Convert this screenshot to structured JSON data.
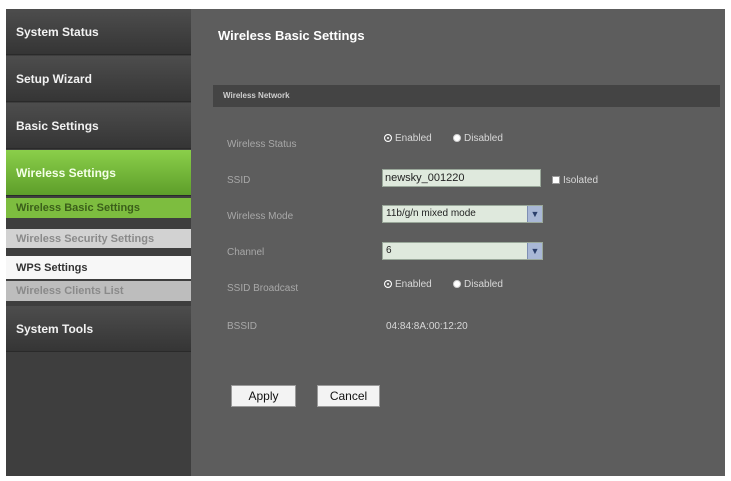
{
  "sidebar": {
    "items": [
      {
        "label": "System Status"
      },
      {
        "label": "Setup Wizard"
      },
      {
        "label": "Basic Settings"
      },
      {
        "label": "Wireless Settings"
      },
      {
        "label": "System Tools"
      }
    ],
    "sub_items": [
      {
        "label": "Wireless Basic Settings"
      },
      {
        "label": "Wireless Security Settings"
      },
      {
        "label": "WPS Settings"
      },
      {
        "label": "Wireless Clients List"
      }
    ]
  },
  "main": {
    "title": "Wireless Basic Settings",
    "section_title": "Wireless Network",
    "fields": {
      "wireless_status": {
        "label": "Wireless Status",
        "enabled_label": "Enabled",
        "disabled_label": "Disabled",
        "selected": "Enabled"
      },
      "ssid": {
        "label": "SSID",
        "value": "newsky_001220",
        "isolated_label": "Isolated"
      },
      "wireless_mode": {
        "label": "Wireless Mode",
        "value": "11b/g/n mixed mode"
      },
      "channel": {
        "label": "Channel",
        "value": "6"
      },
      "ssid_broadcast": {
        "label": "SSID Broadcast",
        "enabled_label": "Enabled",
        "disabled_label": "Disabled",
        "selected": "Enabled"
      },
      "bssid": {
        "label": "BSSID",
        "value": "04:84:8A:00:12:20"
      }
    },
    "buttons": {
      "apply": "Apply",
      "cancel": "Cancel"
    }
  },
  "colors": {
    "active_green": "#6fb23a",
    "frame_dark": "#3e3e3e",
    "main_bg": "#5d5d5d"
  }
}
